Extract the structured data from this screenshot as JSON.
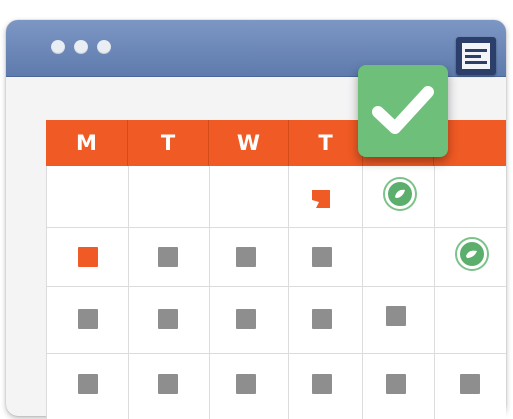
{
  "window": {
    "title_dots": 3,
    "menu_icon": "hamburger-menu-icon"
  },
  "calendar": {
    "day_headers": [
      "M",
      "T",
      "W",
      "T",
      "",
      ""
    ],
    "accent_color": "#f05a24",
    "completed_color": "#6ebf7a",
    "checkmark_icon": "checkmark-icon"
  }
}
